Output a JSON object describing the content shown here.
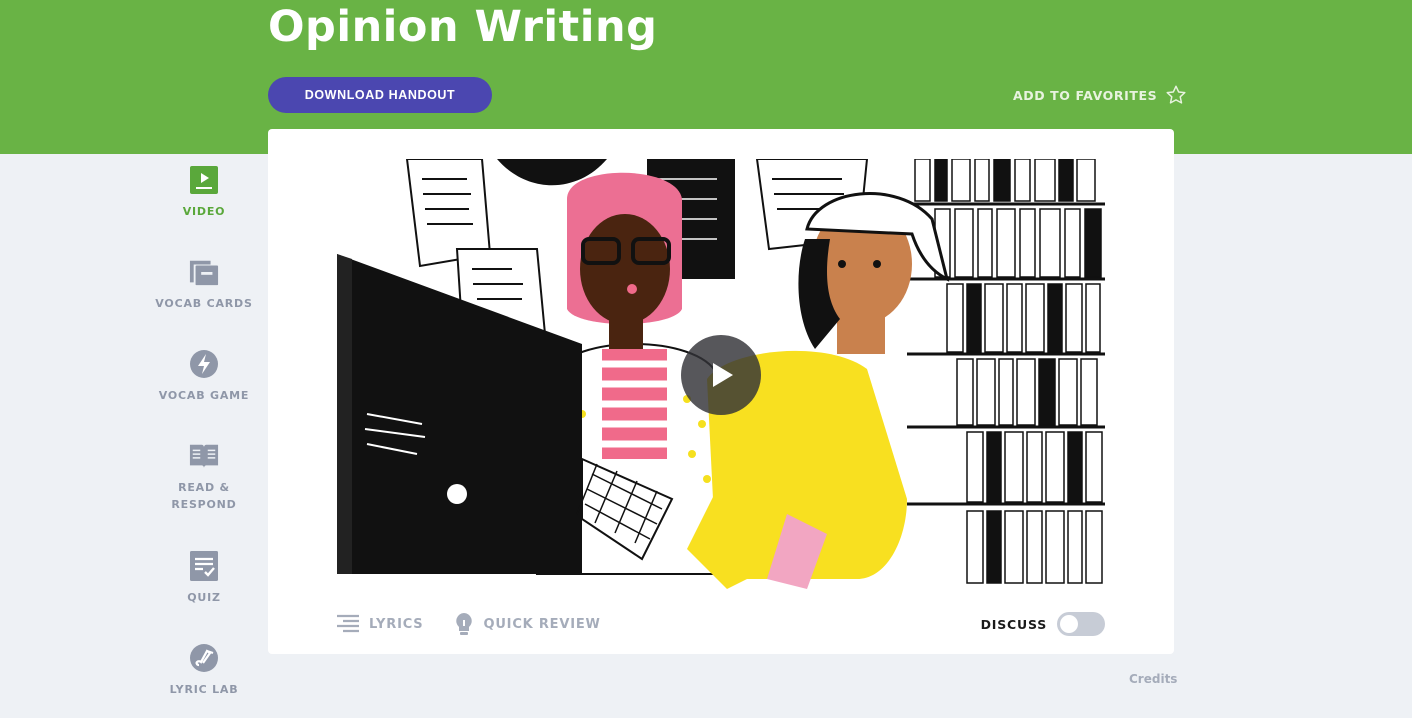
{
  "header": {
    "title": "Opinion Writing",
    "download_label": "DOWNLOAD HANDOUT",
    "favorites_label": "ADD TO FAVORITES"
  },
  "sidebar": {
    "items": [
      {
        "label": "VIDEO",
        "icon": "video-icon",
        "active": true
      },
      {
        "label": "VOCAB CARDS",
        "icon": "vocab-cards-icon"
      },
      {
        "label": "VOCAB GAME",
        "icon": "lightning-icon"
      },
      {
        "label": "READ &\nRESPOND",
        "icon": "book-icon"
      },
      {
        "label": "QUIZ",
        "icon": "quiz-checklist-icon"
      },
      {
        "label": "LYRIC LAB",
        "icon": "lyric-lab-icon"
      }
    ]
  },
  "video": {
    "tools": {
      "lyrics_label": "LYRICS",
      "quick_review_label": "QUICK REVIEW"
    },
    "discuss_label": "DISCUSS",
    "discuss_on": false
  },
  "footer": {
    "credits_label": "Credits"
  },
  "colors": {
    "header_green": "#69b345",
    "button_purple": "#4b47b0",
    "active_green": "#5aa83b",
    "muted": "#8f97a8"
  }
}
